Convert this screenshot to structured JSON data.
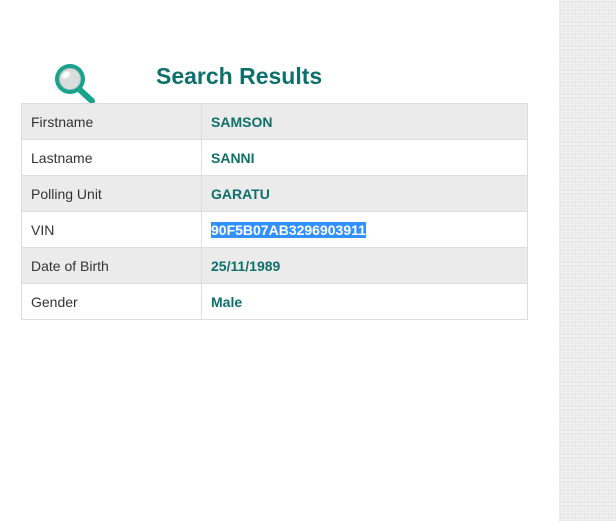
{
  "heading": "Search Results",
  "colors": {
    "accent": "#0e6f6b",
    "icon": "#1aa38c",
    "selection": "#3390ff",
    "row_alt": "#ebebeb"
  },
  "icons": {
    "magnifier": "search-icon"
  },
  "results": [
    {
      "label": "Firstname",
      "value": "SAMSON"
    },
    {
      "label": "Lastname",
      "value": "SANNI"
    },
    {
      "label": "Polling Unit",
      "value": "GARATU"
    },
    {
      "label": "VIN",
      "value": "90F5B07AB3296903911"
    },
    {
      "label": "Date of Birth",
      "value": "25/11/1989"
    },
    {
      "label": "Gender",
      "value": "Male"
    }
  ]
}
